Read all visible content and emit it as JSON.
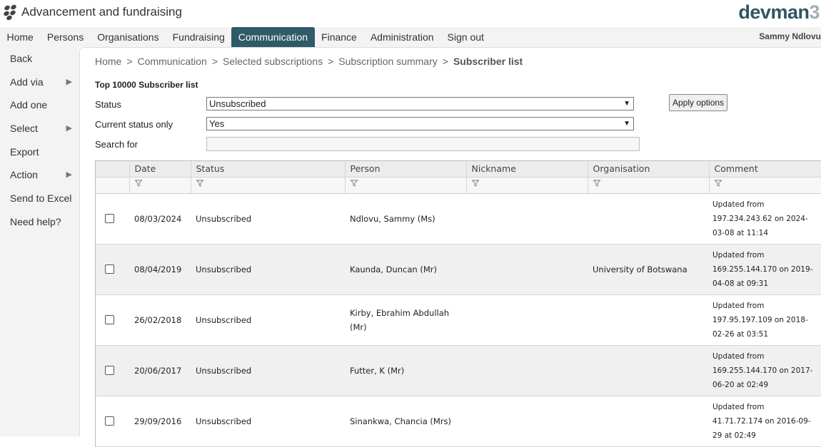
{
  "app": {
    "title": "Advancement and fundraising",
    "brand": "devman",
    "brand_suffix": "3",
    "user": "Sammy Ndlovu"
  },
  "nav": [
    {
      "label": "Home"
    },
    {
      "label": "Persons"
    },
    {
      "label": "Organisations"
    },
    {
      "label": "Fundraising"
    },
    {
      "label": "Communication",
      "active": true
    },
    {
      "label": "Finance"
    },
    {
      "label": "Administration"
    },
    {
      "label": "Sign out"
    }
  ],
  "sidebar": [
    {
      "label": "Back"
    },
    {
      "label": "Add via",
      "submenu": true
    },
    {
      "label": "Add one"
    },
    {
      "label": "Select",
      "submenu": true
    },
    {
      "label": "Export"
    },
    {
      "label": "Action",
      "submenu": true
    },
    {
      "label": "Send to Excel"
    },
    {
      "label": "Need help?"
    }
  ],
  "breadcrumb": [
    "Home",
    "Communication",
    "Selected subscriptions",
    "Subscription summary",
    "Subscriber list"
  ],
  "form": {
    "heading": "Top 10000 Subscriber list",
    "status_label": "Status",
    "status_value": "Unsubscribed",
    "current_label": "Current status only",
    "current_value": "Yes",
    "search_label": "Search for",
    "search_value": "",
    "apply": "Apply options"
  },
  "table": {
    "columns": [
      "Date",
      "Status",
      "Person",
      "Nickname",
      "Organisation",
      "Comment"
    ],
    "rows": [
      {
        "date": "08/03/2024",
        "status": "Unsubscribed",
        "person": "Ndlovu, Sammy (Ms)",
        "nickname": "",
        "org": "",
        "comment": "Updated from\n197.234.243.62 on 2024-\n03-08 at 11:14"
      },
      {
        "date": "08/04/2019",
        "status": "Unsubscribed",
        "person": "Kaunda, Duncan (Mr)",
        "nickname": "",
        "org": "University of Botswana",
        "comment": "Updated from\n169.255.144.170 on 2019-\n04-08 at 09:31"
      },
      {
        "date": "26/02/2018",
        "status": "Unsubscribed",
        "person": "Kirby, Ebrahim Abdullah\n(Mr)",
        "nickname": "",
        "org": "",
        "comment": "Updated from\n197.95.197.109 on 2018-\n02-26 at 03:51"
      },
      {
        "date": "20/06/2017",
        "status": "Unsubscribed",
        "person": "Futter, K (Mr)",
        "nickname": "",
        "org": "",
        "comment": "Updated from\n169.255.144.170 on 2017-\n06-20 at 02:49"
      },
      {
        "date": "29/09/2016",
        "status": "Unsubscribed",
        "person": "Sinankwa, Chancia (Mrs)",
        "nickname": "",
        "org": "",
        "comment": "Updated from\n41.71.72.174 on 2016-09-\n29 at 02:49"
      }
    ]
  },
  "colors": {
    "accent": "#2f5a68",
    "brand": "#2f5560"
  }
}
